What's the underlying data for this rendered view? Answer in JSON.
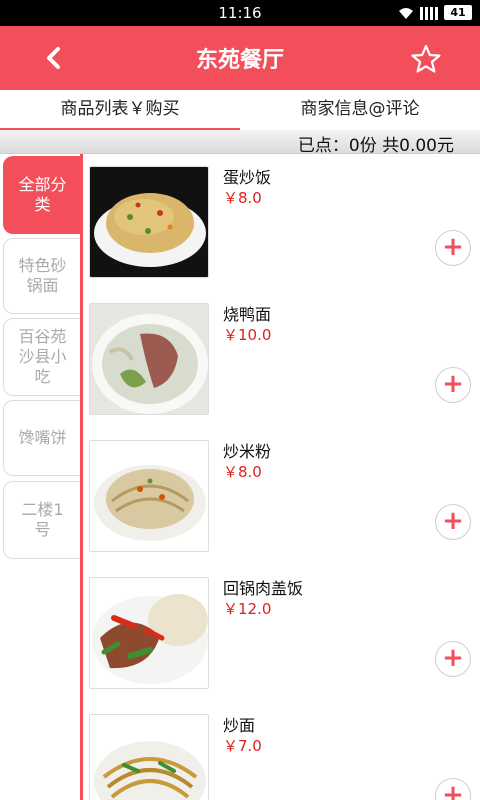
{
  "status_bar": {
    "time": "11:16",
    "battery": "41"
  },
  "header": {
    "title": "东苑餐厅",
    "back_icon": "chevron-left-icon",
    "favorite_icon": "star-outline-icon"
  },
  "tabs": [
    {
      "label": "商品列表￥购买",
      "active": true
    },
    {
      "label": "商家信息@评论",
      "active": false
    }
  ],
  "summary": {
    "text": "已点：0份 共0.00元"
  },
  "sidebar": {
    "categories": [
      {
        "label": "全部分类",
        "active": true
      },
      {
        "label": "特色砂锅面",
        "active": false
      },
      {
        "label": "百谷苑沙县小吃",
        "active": false
      },
      {
        "label": "馋嘴饼",
        "active": false
      },
      {
        "label": "二楼1号",
        "active": false
      }
    ]
  },
  "items": [
    {
      "name": "蛋炒饭",
      "price": "￥8.0",
      "add_label": "+"
    },
    {
      "name": "烧鸭面",
      "price": "￥10.0",
      "add_label": "+"
    },
    {
      "name": "炒米粉",
      "price": "￥8.0",
      "add_label": "+"
    },
    {
      "name": "回锅肉盖饭",
      "price": "￥12.0",
      "add_label": "+"
    },
    {
      "name": "炒面",
      "price": "￥7.0",
      "add_label": "+"
    }
  ],
  "colors": {
    "accent": "#f34f5b",
    "price": "#e02020"
  }
}
